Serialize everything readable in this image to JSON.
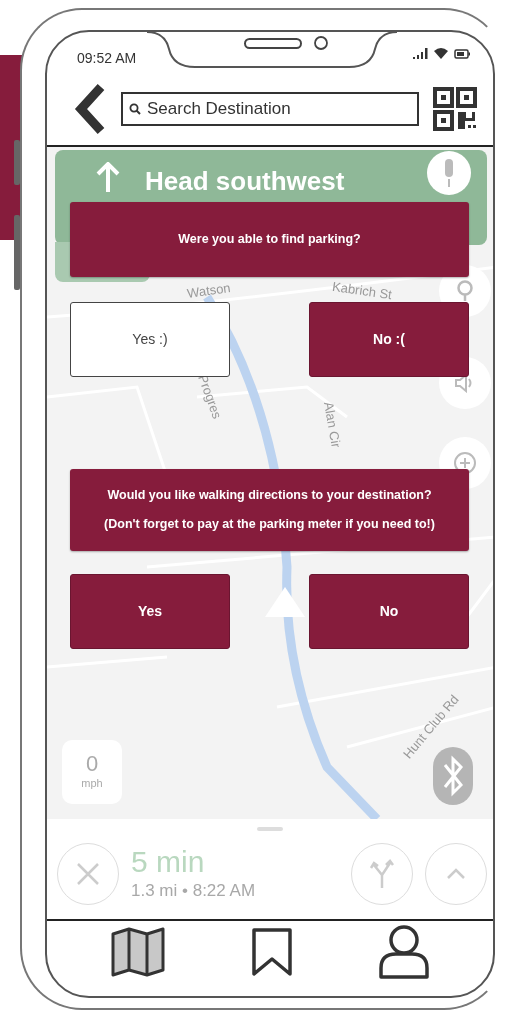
{
  "status_bar": {
    "time": "09:52 AM"
  },
  "header": {
    "search": {
      "placeholder": "Search Destination"
    }
  },
  "map": {
    "direction": "Head southwest",
    "street_labels": [
      "Watson",
      "Kabrich St",
      "Progres",
      "Alan Cir",
      "Hunt Club Rd"
    ],
    "speed": {
      "value": "0",
      "unit": "mph"
    }
  },
  "dialogs": [
    {
      "message": [
        "Were you able to find parking?"
      ],
      "buttons": [
        {
          "label": "Yes :)",
          "selected": true
        },
        {
          "label": "No :(",
          "selected": false
        }
      ]
    },
    {
      "message": [
        "Would you like walking directions to your destination?",
        "(Don't forget to pay at the parking meter if you need to!)"
      ],
      "buttons": [
        {
          "label": "Yes",
          "selected": false
        },
        {
          "label": "No",
          "selected": false
        }
      ]
    }
  ],
  "trip": {
    "duration": "5 min",
    "details": "1.3 mi • 8:22 AM"
  },
  "tab_bar": [
    {
      "kind": "map",
      "selected": true
    },
    {
      "kind": "bookmark",
      "selected": false
    },
    {
      "kind": "profile",
      "selected": false
    }
  ]
}
